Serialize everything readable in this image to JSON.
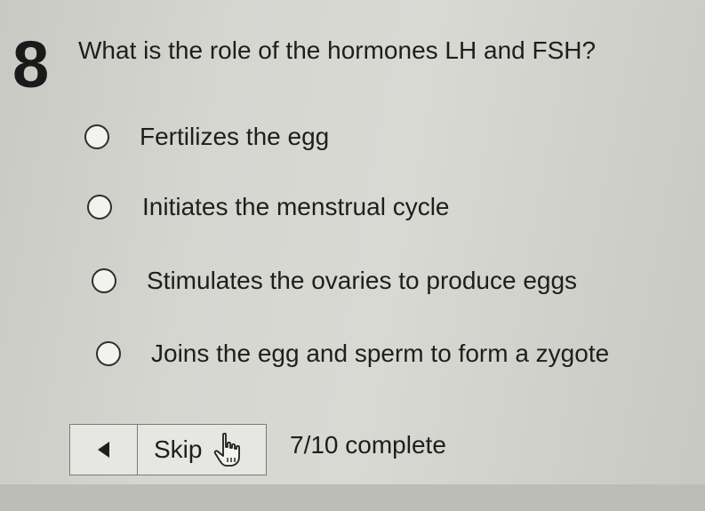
{
  "question": {
    "number": "8",
    "text": "What is the role of the hormones LH and FSH?"
  },
  "options": [
    {
      "label": "Fertilizes the egg"
    },
    {
      "label": "Initiates the menstrual cycle"
    },
    {
      "label": "Stimulates the ovaries to produce eggs"
    },
    {
      "label": "Joins the egg and sperm to form a zygote"
    }
  ],
  "navigation": {
    "back_icon": "left-triangle-icon",
    "skip_label": "Skip",
    "cursor_icon": "hand-pointer-icon"
  },
  "progress": {
    "text": "7/10 complete",
    "completed": 7,
    "total": 10
  }
}
